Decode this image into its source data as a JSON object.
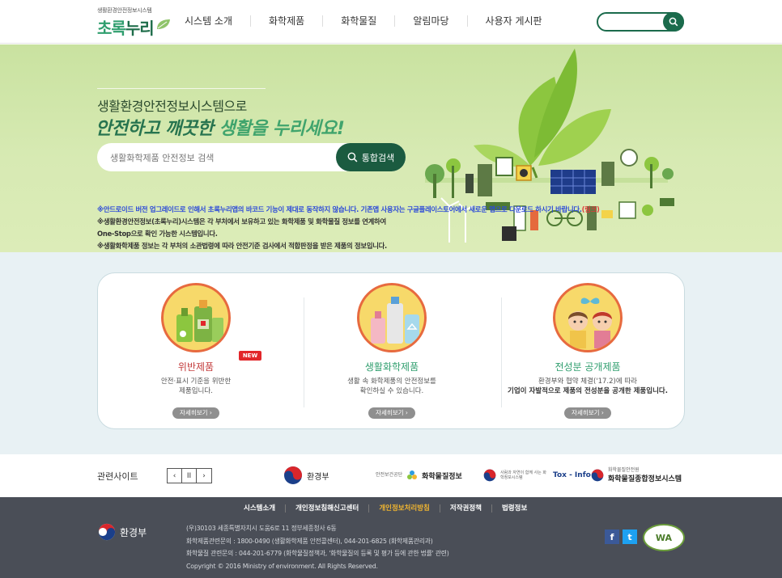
{
  "header": {
    "logo_small": "생활환경안전정보시스템",
    "logo_big_1": "초록",
    "logo_big_2": "누리",
    "nav": [
      "시스템 소개",
      "화학제품",
      "화학물질",
      "알림마당",
      "사용자 게시판"
    ],
    "search_placeholder": ""
  },
  "hero": {
    "line1": "생활환경안전정보시스템으로",
    "line2a": "안전하고 깨끗한 ",
    "line2b": "생활을 누리세요!",
    "search_placeholder": "생활화학제품 안전정보 검색",
    "search_button": "통합검색",
    "notice1": "※안드로이드 버전 업그레이드로 인해서 초록누리앱의 바코드 기능이 제대로 동작하지 않습니다. 기존앱 사용자는 구글플레이스토어에서 새로운 앱으로 다운로드 하시기 바랍니다.",
    "notice1_link": "(링크)",
    "notice2": "※생활환경안전정보(초록누리)시스템은 각 부처에서 보유하고 있는 화학제품 및 화학물질 정보를 연계하여",
    "notice3": "One-Stop으로 확인 가능한 시스템입니다.",
    "notice4": "※생활화학제품 정보는 각 부처의 소관법령에 따라 안전기준 검사에서 적합판정을 받은 제품의 정보입니다."
  },
  "cards": [
    {
      "title": "위반제품",
      "desc1": "안전·표시 기준을 위반한",
      "desc2": "제품입니다.",
      "more": "자세히보기 ›",
      "badge": "NEW"
    },
    {
      "title": "생활화학제품",
      "desc1": "생활 속 화학제품의 안전정보를",
      "desc2": "확인하실 수 있습니다.",
      "more": "자세히보기 ›"
    },
    {
      "title": "전성분 공개제품",
      "desc1": "환경부와 협약 체결('17.2)에 따라",
      "desc2": "기업이 자발적으로 제품의 전성분을 공개한 제품입니다.",
      "more": "자세히보기 ›"
    }
  ],
  "related": {
    "label": "관련사이트",
    "prev": "‹",
    "pause": "II",
    "next": "›",
    "sites": [
      {
        "name": "환경부"
      },
      {
        "sub": "안전보건공단",
        "name": "화학물질정보"
      },
      {
        "sub": "사람과 자연이 함께 사는 화학정보시스템",
        "name": "Tox - Info"
      },
      {
        "sub": "화학물질안전원",
        "name": "화학물질종합정보시스템"
      }
    ]
  },
  "footer": {
    "links": [
      "시스템소개",
      "개인정보침해신고센터",
      "개인정보처리방침",
      "저작권정책",
      "법령정보"
    ],
    "logo": "환경부",
    "addr1": "(우)30103 세종특별자치시 도움6로 11 정부세종청사 6동",
    "addr2": "화학제품관련문의 : 1800-0490 (생활화학제품 안전콜센터), 044-201-6825 (화학제품관리과)",
    "addr3": "화학물질 관련문의 : 044-201-6779 (화학물질정책과, '화학물질의 등록 및 평가 등에 관한 법률' 관련)",
    "addr4": "Copyright © 2016 Ministry of environment. All Rights Reserved.",
    "fb": "f",
    "tw": "t",
    "wa": "WA"
  },
  "colors": {
    "brand": "#2f9e6e",
    "dark_green": "#1b5b40",
    "hero_bg": "#d3e8ad",
    "footer_bg": "#4a4e57",
    "accent_red": "#e2262a",
    "highlight": "#f2b630"
  }
}
